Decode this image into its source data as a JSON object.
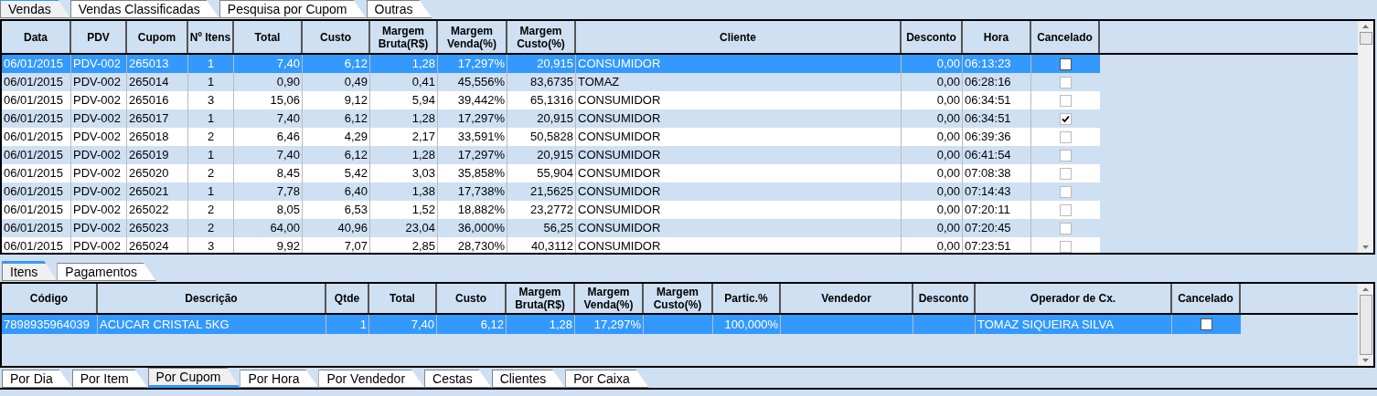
{
  "top_tabs": [
    {
      "label": "Vendas",
      "selected": true
    },
    {
      "label": "Vendas Classificadas",
      "selected": false
    },
    {
      "label": "Pesquisa por Cupom",
      "selected": false
    },
    {
      "label": "Outras",
      "selected": false
    }
  ],
  "sales_table": {
    "columns": [
      "Data",
      "PDV",
      "Cupom",
      "Nº Itens",
      "Total",
      "Custo",
      "Margem Bruta(R$)",
      "Margem Venda(%)",
      "Margem Custo(%)",
      "Cliente",
      "Desconto",
      "Hora",
      "Cancelado"
    ],
    "rows": [
      {
        "selected": true,
        "cells": [
          "06/01/2015",
          "PDV-002",
          "265013",
          "1",
          "7,40",
          "6,12",
          "1,28",
          "17,297%",
          "20,915",
          "CONSUMIDOR",
          "0,00",
          "06:13:23"
        ],
        "cancelado": false
      },
      {
        "selected": false,
        "cells": [
          "06/01/2015",
          "PDV-002",
          "265014",
          "1",
          "0,90",
          "0,49",
          "0,41",
          "45,556%",
          "83,6735",
          "TOMAZ",
          "0,00",
          "06:28:16"
        ],
        "cancelado": false
      },
      {
        "selected": false,
        "cells": [
          "06/01/2015",
          "PDV-002",
          "265016",
          "3",
          "15,06",
          "9,12",
          "5,94",
          "39,442%",
          "65,1316",
          "CONSUMIDOR",
          "0,00",
          "06:34:51"
        ],
        "cancelado": false
      },
      {
        "selected": false,
        "cells": [
          "06/01/2015",
          "PDV-002",
          "265017",
          "1",
          "7,40",
          "6,12",
          "1,28",
          "17,297%",
          "20,915",
          "CONSUMIDOR",
          "0,00",
          "06:34:51"
        ],
        "cancelado": true
      },
      {
        "selected": false,
        "cells": [
          "06/01/2015",
          "PDV-002",
          "265018",
          "2",
          "6,46",
          "4,29",
          "2,17",
          "33,591%",
          "50,5828",
          "CONSUMIDOR",
          "0,00",
          "06:39:36"
        ],
        "cancelado": false
      },
      {
        "selected": false,
        "cells": [
          "06/01/2015",
          "PDV-002",
          "265019",
          "1",
          "7,40",
          "6,12",
          "1,28",
          "17,297%",
          "20,915",
          "CONSUMIDOR",
          "0,00",
          "06:41:54"
        ],
        "cancelado": false
      },
      {
        "selected": false,
        "cells": [
          "06/01/2015",
          "PDV-002",
          "265020",
          "2",
          "8,45",
          "5,42",
          "3,03",
          "35,858%",
          "55,904",
          "CONSUMIDOR",
          "0,00",
          "07:08:38"
        ],
        "cancelado": false
      },
      {
        "selected": false,
        "cells": [
          "06/01/2015",
          "PDV-002",
          "265021",
          "1",
          "7,78",
          "6,40",
          "1,38",
          "17,738%",
          "21,5625",
          "CONSUMIDOR",
          "0,00",
          "07:14:43"
        ],
        "cancelado": false
      },
      {
        "selected": false,
        "cells": [
          "06/01/2015",
          "PDV-002",
          "265022",
          "2",
          "8,05",
          "6,53",
          "1,52",
          "18,882%",
          "23,2772",
          "CONSUMIDOR",
          "0,00",
          "07:20:11"
        ],
        "cancelado": false
      },
      {
        "selected": false,
        "cells": [
          "06/01/2015",
          "PDV-002",
          "265023",
          "2",
          "64,00",
          "40,96",
          "23,04",
          "36,000%",
          "56,25",
          "CONSUMIDOR",
          "0,00",
          "07:20:45"
        ],
        "cancelado": false
      },
      {
        "selected": false,
        "cells": [
          "06/01/2015",
          "PDV-002",
          "265024",
          "3",
          "9,92",
          "7,07",
          "2,85",
          "28,730%",
          "40,3112",
          "CONSUMIDOR",
          "0,00",
          "07:23:51"
        ],
        "cancelado": false
      }
    ]
  },
  "detail_tabs": [
    {
      "label": "Itens",
      "selected": true
    },
    {
      "label": "Pagamentos",
      "selected": false
    }
  ],
  "items_table": {
    "columns": [
      "Código",
      "Descrição",
      "Qtde",
      "Total",
      "Custo",
      "Margem Bruta(R$)",
      "Margem Venda(%)",
      "Margem Custo(%)",
      "Partic.%",
      "Vendedor",
      "Desconto",
      "Operador de Cx.",
      "Cancelado"
    ],
    "rows": [
      {
        "selected": true,
        "cells": [
          "7898935964039",
          "ACUCAR CRISTAL 5KG",
          "1",
          "7,40",
          "6,12",
          "1,28",
          "17,297%",
          "",
          "100,000%",
          "",
          "",
          "TOMAZ SIQUEIRA SILVA"
        ],
        "cancelado": false
      }
    ]
  },
  "bottom_tabs": [
    {
      "label": "Por Dia",
      "selected": false
    },
    {
      "label": "Por Item",
      "selected": false
    },
    {
      "label": "Por Cupom",
      "selected": true
    },
    {
      "label": "Por Hora",
      "selected": false
    },
    {
      "label": "Por Vendedor",
      "selected": false
    },
    {
      "label": "Cestas",
      "selected": false
    },
    {
      "label": "Clientes",
      "selected": false
    },
    {
      "label": "Por Caixa",
      "selected": false
    }
  ]
}
